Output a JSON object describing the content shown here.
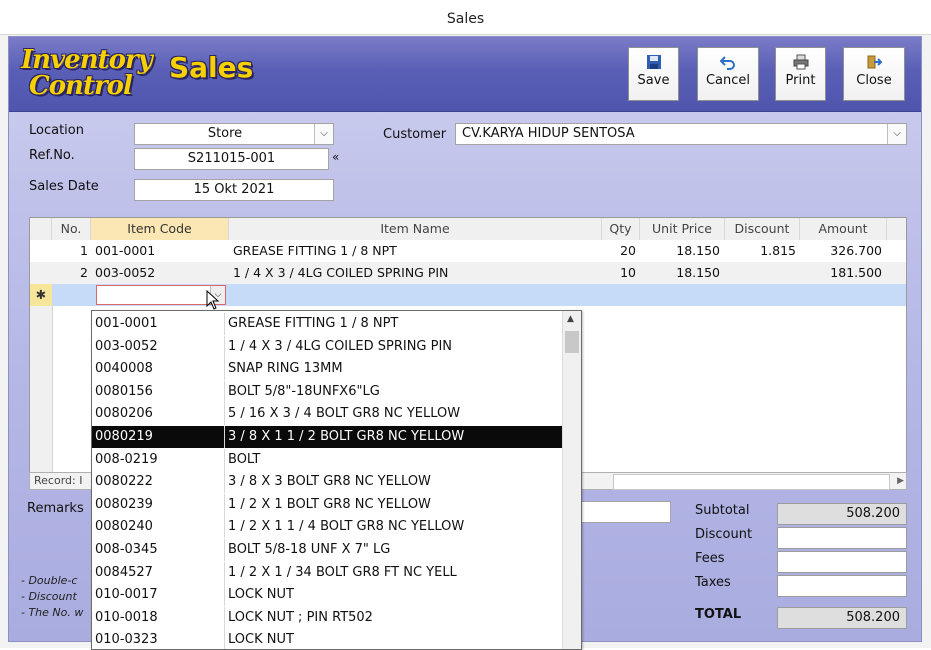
{
  "window": {
    "title": "Sales"
  },
  "header": {
    "logo_line1": "Inventory",
    "logo_line2": "Control",
    "title": "Sales",
    "buttons": [
      {
        "label": "Save",
        "icon": "save-icon"
      },
      {
        "label": "Cancel",
        "icon": "undo-icon"
      },
      {
        "label": "Print",
        "icon": "printer-icon"
      },
      {
        "label": "Close",
        "icon": "exit-icon"
      }
    ]
  },
  "form": {
    "location_label": "Location",
    "location_value": "Store",
    "refno_label": "Ref.No.",
    "refno_value": "S211015-001",
    "refno_nav": "«",
    "salesdate_label": "Sales Date",
    "salesdate_value": "15 Okt 2021",
    "customer_label": "Customer",
    "customer_value": "CV.KARYA HIDUP SENTOSA"
  },
  "grid": {
    "columns": [
      "No.",
      "Item Code",
      "Item Name",
      "Qty",
      "Unit Price",
      "Discount",
      "Amount"
    ],
    "rows": [
      {
        "no": "1",
        "code": "001-0001",
        "name": "GREASE FITTING 1 / 8 NPT",
        "qty": "20",
        "price": "18.150",
        "discount": "1.815",
        "amount": "326.700"
      },
      {
        "no": "2",
        "code": "003-0052",
        "name": "1 / 4 X 3 / 4LG COILED SPRING PIN",
        "qty": "10",
        "price": "18.150",
        "discount": "",
        "amount": "181.500"
      }
    ],
    "new_row_marker": "✱",
    "record_label": "Record: I"
  },
  "dropdown": {
    "selected_index": 5,
    "items": [
      {
        "code": "001-0001",
        "name": "GREASE FITTING 1 / 8 NPT"
      },
      {
        "code": "003-0052",
        "name": "1 / 4 X 3 / 4LG COILED SPRING PIN"
      },
      {
        "code": "0040008",
        "name": "SNAP RING 13MM"
      },
      {
        "code": "0080156",
        "name": "BOLT 5/8\"-18UNFX6\"LG"
      },
      {
        "code": "0080206",
        "name": "5 / 16 X 3 / 4 BOLT GR8 NC YELLOW"
      },
      {
        "code": "0080219",
        "name": "3 / 8 X 1 1 / 2 BOLT GR8 NC YELLOW"
      },
      {
        "code": "008-0219",
        "name": "BOLT"
      },
      {
        "code": "0080222",
        "name": "3 / 8 X 3 BOLT GR8 NC YELLOW"
      },
      {
        "code": "0080239",
        "name": "1 / 2 X 1 BOLT GR8 NC YELLOW"
      },
      {
        "code": "0080240",
        "name": "1 / 2 X 1 1 / 4 BOLT GR8 NC YELLOW"
      },
      {
        "code": "008-0345",
        "name": "BOLT 5/8-18 UNF X 7\" LG"
      },
      {
        "code": "0084527",
        "name": "1 / 2 X 1 / 34 BOLT GR8 FT NC YELL"
      },
      {
        "code": "010-0017",
        "name": "LOCK NUT"
      },
      {
        "code": "010-0018",
        "name": "LOCK NUT ; PIN RT502"
      },
      {
        "code": "010-0323",
        "name": "LOCK NUT"
      }
    ]
  },
  "footer": {
    "remarks_label": "Remarks",
    "notes": [
      "- Double-c",
      "- Discount",
      "- The No. w"
    ],
    "subtotal_label": "Subtotal",
    "subtotal_value": "508.200",
    "discount_label": "Discount",
    "discount_value": "",
    "fees_label": "Fees",
    "fees_value": "",
    "taxes_label": "Taxes",
    "taxes_value": "",
    "total_label": "TOTAL",
    "total_value": "508.200"
  }
}
